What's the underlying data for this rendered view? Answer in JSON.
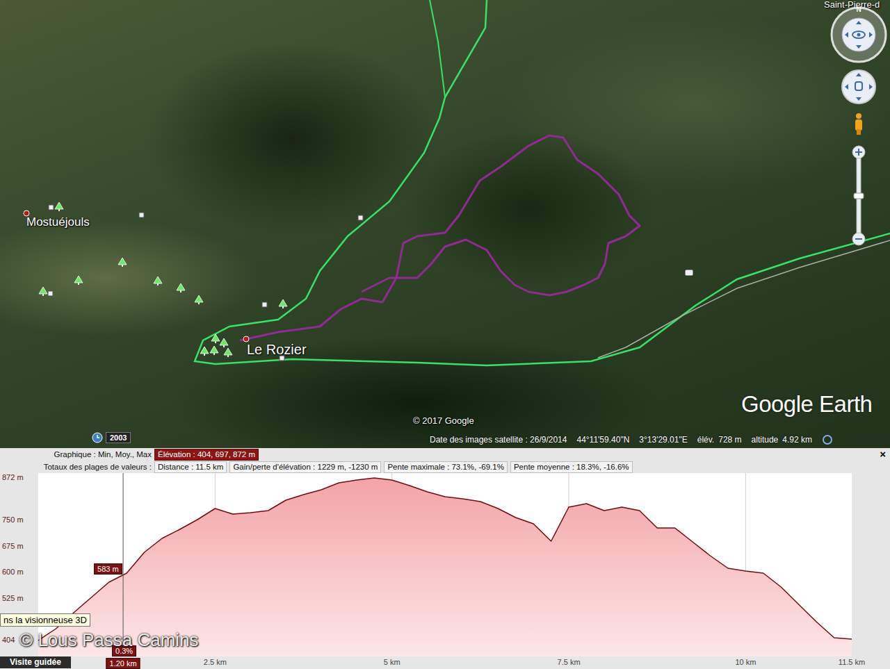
{
  "map": {
    "places": [
      {
        "label": "Mostuéjouls"
      },
      {
        "label": "Le Rozier"
      },
      {
        "label": "Saint-Pierre-d"
      }
    ],
    "compass": "N",
    "history_badge": "2003",
    "copyright": "© 2017 Google",
    "logo": "Google Earth",
    "status_bar": {
      "imagery_date": "Date des images satellite : 26/9/2014",
      "lat": "44°11'59.40\"N",
      "lon": "3°13'29.01\"E",
      "elevation_label": "élév.",
      "elevation": "728 m",
      "altitude_label": "altitude",
      "altitude": "4.92 km"
    }
  },
  "profile": {
    "close": "×",
    "rows": [
      {
        "label": "Graphique : Min, Moy., Max",
        "fields": [
          {
            "text": "Élévation : 404, 697, 872 m",
            "selected": true
          }
        ]
      },
      {
        "label": "Totaux des plages de valeurs :",
        "fields": [
          {
            "text": "Distance : 11.5 km",
            "selected": false
          },
          {
            "text": "Gain/perte d'élévation : 1229 m, -1230 m",
            "selected": false
          },
          {
            "text": "Pente maximale : 73.1%, -69.1%",
            "selected": false
          },
          {
            "text": "Pente moyenne : 18.3%, -16.6%",
            "selected": false
          }
        ]
      }
    ],
    "y_ticks": [
      {
        "label": "872 m",
        "value": 872
      },
      {
        "label": "750 m",
        "value": 750
      },
      {
        "label": "675 m",
        "value": 675
      },
      {
        "label": "600 m",
        "value": 600
      },
      {
        "label": "525 m",
        "value": 525
      },
      {
        "label": "404",
        "value": 404
      }
    ],
    "x_ticks": [
      {
        "label": "2.5 km",
        "value": 2.5
      },
      {
        "label": "5 km",
        "value": 5
      },
      {
        "label": "7.5 km",
        "value": 7.5
      },
      {
        "label": "10 km",
        "value": 10
      },
      {
        "label": "11.5 km",
        "value": 11.5
      }
    ],
    "series": {
      "values": [
        404,
        438,
        484,
        528,
        572,
        598,
        658,
        698,
        724,
        752,
        784,
        768,
        772,
        778,
        808,
        824,
        838,
        858,
        866,
        872,
        866,
        850,
        832,
        818,
        812,
        804,
        784,
        758,
        740,
        690,
        788,
        798,
        778,
        788,
        778,
        728,
        728,
        688,
        648,
        612,
        604,
        598,
        558,
        508,
        458,
        412,
        408
      ]
    },
    "cursor": {
      "km": 1.2,
      "distance": "1.20 km",
      "elevation_value": 583,
      "elevation": "583 m",
      "slope": "0.3%"
    },
    "tooltip": "ns la visionneuse 3D",
    "guided_tour": "Visite guidée",
    "watermark": "© Lous Passa Camins"
  }
}
